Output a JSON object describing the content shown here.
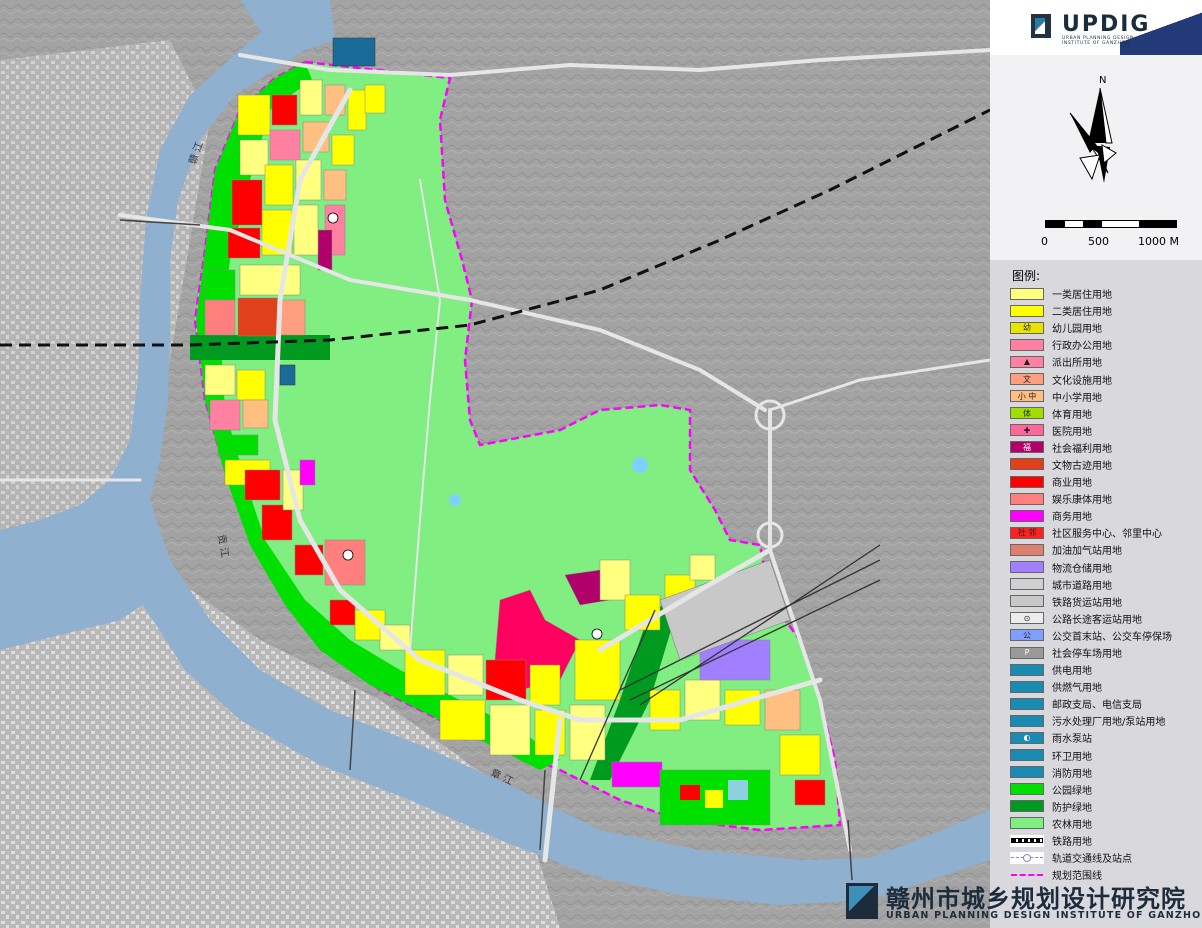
{
  "header": {
    "logo_text": "UPDIG",
    "logo_sub": "URBAN PLANNING DESIGN INSTITUTE OF GANZHOU"
  },
  "compass": {
    "north": "N",
    "scale": {
      "start": "0",
      "mid": "500",
      "end": "1000 M"
    }
  },
  "legend": {
    "title": "图例:",
    "items": [
      {
        "label": "一类居住用地",
        "color": "#ffff80",
        "glyph": ""
      },
      {
        "label": "二类居住用地",
        "color": "#ffff00",
        "glyph": ""
      },
      {
        "label": "幼儿园用地",
        "color": "#e6e600",
        "glyph": "幼"
      },
      {
        "label": "行政办公用地",
        "color": "#ff80a0",
        "glyph": ""
      },
      {
        "label": "派出所用地",
        "color": "#ff80a0",
        "glyph": "▲"
      },
      {
        "label": "文化设施用地",
        "color": "#ff9f7f",
        "glyph": "文"
      },
      {
        "label": "中小学用地",
        "color": "#ffbf80",
        "glyph": "小 中"
      },
      {
        "label": "体育用地",
        "color": "#a0e000",
        "glyph": "体"
      },
      {
        "label": "医院用地",
        "color": "#ff6699",
        "glyph": "✚"
      },
      {
        "label": "社会福利用地",
        "color": "#b0006a",
        "glyph": "福"
      },
      {
        "label": "文物古迹用地",
        "color": "#e0401a",
        "glyph": ""
      },
      {
        "label": "商业用地",
        "color": "#ff0000",
        "glyph": ""
      },
      {
        "label": "娱乐康体用地",
        "color": "#ff7f7f",
        "glyph": ""
      },
      {
        "label": "商务用地",
        "color": "#ff00ff",
        "glyph": ""
      },
      {
        "label": "社区服务中心、邻里中心",
        "color": "#ff2020",
        "glyph": "社 邻"
      },
      {
        "label": "加油加气站用地",
        "color": "#dd8070",
        "glyph": ""
      },
      {
        "label": "物流仓储用地",
        "color": "#a080ff",
        "glyph": ""
      },
      {
        "label": "城市道路用地",
        "color": "#d0d0d0",
        "glyph": ""
      },
      {
        "label": "铁路货运站用地",
        "color": "#c8c8c8",
        "glyph": ""
      },
      {
        "label": "公路长途客运站用地",
        "color": "#ececec",
        "glyph": "⊙"
      },
      {
        "label": "公交首末站、公交车停保场",
        "color": "#80a0ff",
        "glyph": "公"
      },
      {
        "label": "社会停车场用地",
        "color": "#999999",
        "glyph": "P"
      },
      {
        "label": "供电用地",
        "color": "#1a8cb3",
        "glyph": ""
      },
      {
        "label": "供燃气用地",
        "color": "#1a8cb3",
        "glyph": ""
      },
      {
        "label": "邮政支局、电信支局",
        "color": "#1a8cb3",
        "glyph": ""
      },
      {
        "label": "污水处理厂用地/泵站用地",
        "color": "#1a8cb3",
        "glyph": ""
      },
      {
        "label": "雨水泵站",
        "color": "#1a8cb3",
        "glyph": "◐"
      },
      {
        "label": "环卫用地",
        "color": "#1a8cb3",
        "glyph": ""
      },
      {
        "label": "消防用地",
        "color": "#1a8cb3",
        "glyph": ""
      },
      {
        "label": "公园绿地",
        "color": "#00e000",
        "glyph": ""
      },
      {
        "label": "防护绿地",
        "color": "#009a20",
        "glyph": ""
      },
      {
        "label": "农林用地",
        "color": "#80ee80",
        "glyph": ""
      },
      {
        "label": "铁路用地",
        "color": "line-rail",
        "glyph": ""
      },
      {
        "label": "轨道交通线及站点",
        "color": "line-metro",
        "glyph": ""
      },
      {
        "label": "规划范围线",
        "color": "line-boundary",
        "glyph": ""
      }
    ]
  },
  "footer": {
    "name_cn": "赣州市城乡规划设计研究院",
    "name_en": "URBAN PLANNING DESIGN INSTITUTE OF GANZHOU"
  },
  "map": {
    "river_labels": [
      "赣 江",
      "章 江",
      "贡 江"
    ],
    "colors": {
      "terrain": "#a3a3a3",
      "water": "#8fb0cf",
      "farmland": "#80ee80",
      "park": "#00e000",
      "boundary": "#ff00ff"
    }
  }
}
